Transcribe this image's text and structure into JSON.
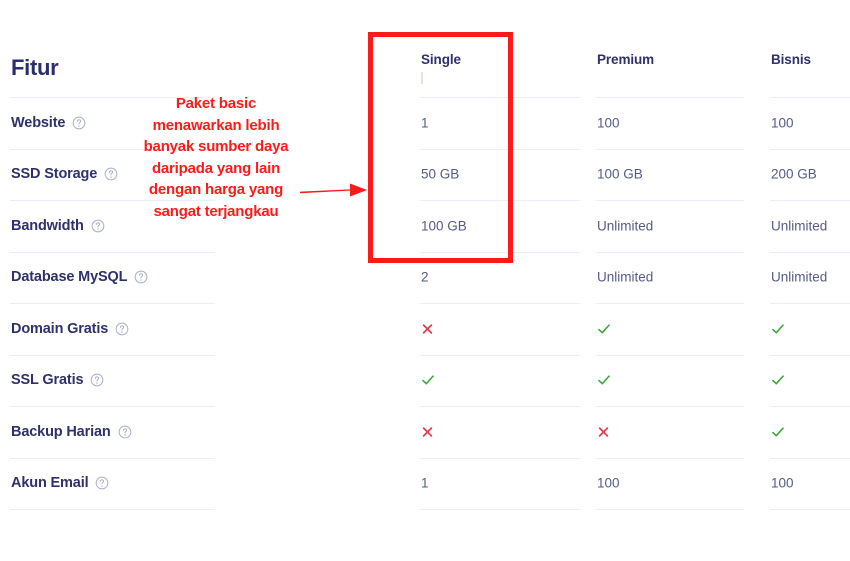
{
  "header": {
    "title": "Fitur",
    "columns": [
      {
        "label": "Single"
      },
      {
        "label": "Premium"
      },
      {
        "label": "Bisnis"
      }
    ]
  },
  "annotation": {
    "text": "Paket basic menawarkan lebih banyak sumber daya daripada yang lain dengan harga yang sangat terjangkau",
    "color": "#fc1b1b",
    "arrow_icon": "arrow-right-icon",
    "highlighted_column": "Single"
  },
  "icons": {
    "help": "help-circle-icon",
    "check": "check-icon",
    "cross": "cross-icon"
  },
  "colors": {
    "title": "#2b2d6e",
    "feature_label": "#30316b",
    "cell_value": "#565b86",
    "check": "#3aa63a",
    "cross": "#e23b4e",
    "annotation": "#fc1b1b",
    "separator": "#eceef6"
  },
  "rows": [
    {
      "feature": "Website",
      "single": "1",
      "premium": "100",
      "bisnis": "100"
    },
    {
      "feature": "SSD Storage",
      "single": "50 GB",
      "premium": "100 GB",
      "bisnis": "200 GB"
    },
    {
      "feature": "Bandwidth",
      "single": "100 GB",
      "premium": "Unlimited",
      "bisnis": "Unlimited"
    },
    {
      "feature": "Database MySQL",
      "single": "2",
      "premium": "Unlimited",
      "bisnis": "Unlimited"
    },
    {
      "feature": "Domain Gratis",
      "single": "no",
      "premium": "yes",
      "bisnis": "yes"
    },
    {
      "feature": "SSL Gratis",
      "single": "yes",
      "premium": "yes",
      "bisnis": "yes"
    },
    {
      "feature": "Backup Harian",
      "single": "no",
      "premium": "no",
      "bisnis": "yes"
    },
    {
      "feature": "Akun Email",
      "single": "1",
      "premium": "100",
      "bisnis": "100"
    }
  ]
}
